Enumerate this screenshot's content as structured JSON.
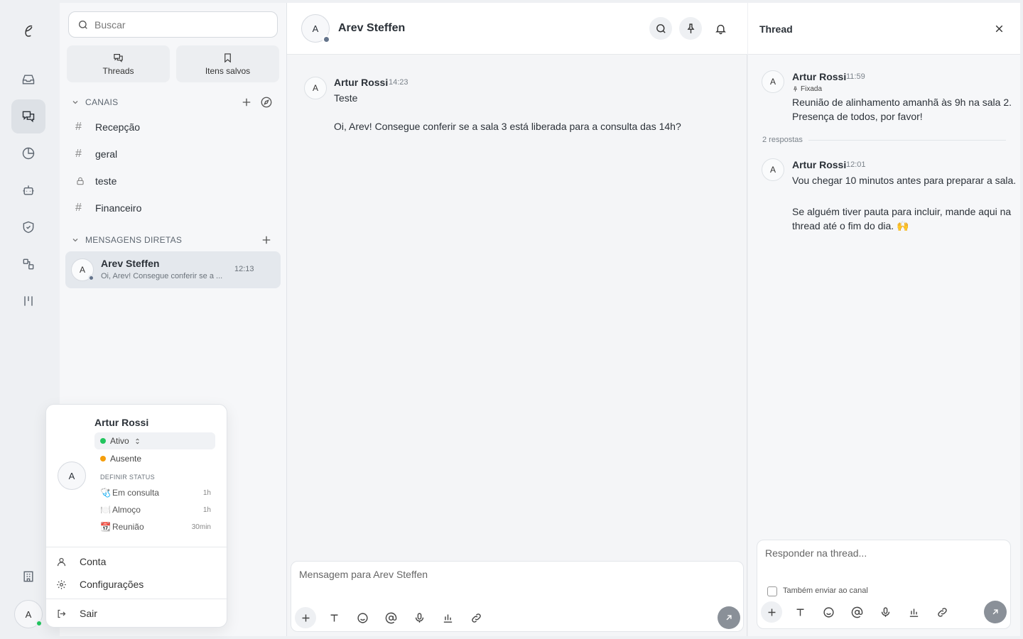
{
  "rail": {
    "logo_letter": "ℯ",
    "avatar_letter": "A",
    "status_color": "#22c55e"
  },
  "sidebar": {
    "search_placeholder": "Buscar",
    "quick_threads": "Threads",
    "quick_saved": "Itens salvos",
    "channels_header": "CANAIS",
    "channels": [
      {
        "name": "Recepção",
        "type": "public"
      },
      {
        "name": "geral",
        "type": "public"
      },
      {
        "name": "teste",
        "type": "private"
      },
      {
        "name": "Financeiro",
        "type": "public"
      }
    ],
    "dm_header": "MENSAGENS DIRETAS",
    "dms": [
      {
        "avatar": "A",
        "name": "Arev Steffen",
        "preview": "Oi, Arev! Consegue conferir se a ...",
        "time": "12:13"
      }
    ]
  },
  "chat": {
    "avatar": "A",
    "title": "Arev Steffen",
    "messages": [
      {
        "avatar": "A",
        "author": "Artur Rossi",
        "time": "14:23",
        "lines": [
          "Teste",
          "Oi, Arev! Consegue conferir se a sala 3 está liberada para a consulta das 14h?"
        ]
      }
    ],
    "composer_placeholder": "Mensagem para Arev Steffen"
  },
  "thread": {
    "title": "Thread",
    "parent": {
      "avatar": "A",
      "author": "Artur Rossi",
      "time": "11:59",
      "pinned_label": "Fixada",
      "text_1": "Reunião de alinhamento amanhã às 9h na sala 2.",
      "text_2": "Presença de todos, por favor!"
    },
    "replies_label": "2 respostas",
    "reply": {
      "avatar": "A",
      "author": "Artur Rossi",
      "time": "12:01",
      "text_1": "Vou chegar 10 minutos antes para preparar a sala.",
      "text_2": "Se alguém tiver pauta para incluir, mande aqui na",
      "text_3": "thread até o fim do dia. 🙌"
    },
    "composer_placeholder": "Responder na thread...",
    "also_send_label": "Também enviar ao canal"
  },
  "profile_popover": {
    "avatar": "A",
    "name": "Artur Rossi",
    "status_active": "Ativo",
    "status_away": "Ausente",
    "active_color": "#22c55e",
    "away_color": "#f59e0b",
    "set_status_label": "DEFINIR STATUS",
    "presets": [
      {
        "emoji": "🩺",
        "label": "Em consulta",
        "duration": "1h"
      },
      {
        "emoji": "🍽️",
        "label": "Almoço",
        "duration": "1h"
      },
      {
        "emoji": "📆",
        "label": "Reunião",
        "duration": "30min"
      }
    ],
    "menu_account": "Conta",
    "menu_settings": "Configurações",
    "menu_logout": "Sair"
  }
}
